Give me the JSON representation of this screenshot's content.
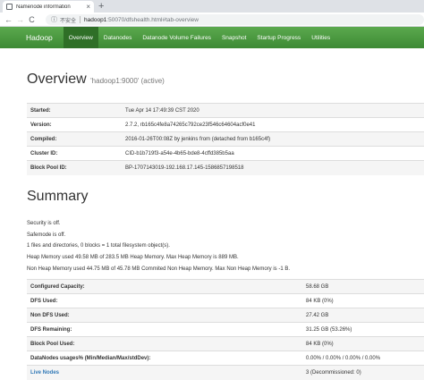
{
  "browser": {
    "tab_title": "Namenode information",
    "tab_close": "×",
    "new_tab": "+",
    "back": "←",
    "forward": "→",
    "reload": "C",
    "insecure_label": "不安全",
    "url_host": "hadoop1",
    "url_rest": ":50070/dfshealth.html#tab-overview"
  },
  "navbar": {
    "brand": "Hadoop",
    "items": [
      {
        "label": "Overview"
      },
      {
        "label": "Datanodes"
      },
      {
        "label": "Datanode Volume Failures"
      },
      {
        "label": "Snapshot"
      },
      {
        "label": "Startup Progress"
      },
      {
        "label": "Utilities"
      }
    ]
  },
  "overview": {
    "title": "Overview",
    "subtitle": "'hadoop1:9000' (active)",
    "rows": [
      {
        "key": "Started:",
        "value": "Tue Apr 14 17:49:39 CST 2020"
      },
      {
        "key": "Version:",
        "value": "2.7.2, rb165c4fe8a74265c792ce23f546c64604acf0e41"
      },
      {
        "key": "Compiled:",
        "value": "2016-01-26T00:08Z by jenkins from (detached from b165c4f)"
      },
      {
        "key": "Cluster ID:",
        "value": "CID-b1b719f3-a54e-4b65-bde8-4cffd385b5aa"
      },
      {
        "key": "Block Pool ID:",
        "value": "BP-1707143019-192.168.17.145-1586857198518"
      }
    ]
  },
  "summary": {
    "title": "Summary",
    "lines": [
      "Security is off.",
      "Safemode is off.",
      "1 files and directories, 0 blocks = 1 total filesystem object(s).",
      "Heap Memory used 49.58 MB of 283.5 MB Heap Memory. Max Heap Memory is 889 MB.",
      "Non Heap Memory used 44.75 MB of 45.78 MB Commited Non Heap Memory. Max Non Heap Memory is -1 B."
    ],
    "rows": [
      {
        "key": "Configured Capacity:",
        "value": "58.68 GB"
      },
      {
        "key": "DFS Used:",
        "value": "84 KB (0%)"
      },
      {
        "key": "Non DFS Used:",
        "value": "27.42 GB"
      },
      {
        "key": "DFS Remaining:",
        "value": "31.25 GB (53.26%)"
      },
      {
        "key": "Block Pool Used:",
        "value": "84 KB (0%)"
      },
      {
        "key": "DataNodes usages% (Min/Median/Max/stdDev):",
        "value": "0.00% / 0.00% / 0.00% / 0.00%"
      },
      {
        "key": "Live Nodes",
        "value": "3 (Decommissioned: 0)"
      }
    ]
  },
  "colors": {
    "navbar_green": "#4a9a3f",
    "link_blue": "#337ab7"
  }
}
